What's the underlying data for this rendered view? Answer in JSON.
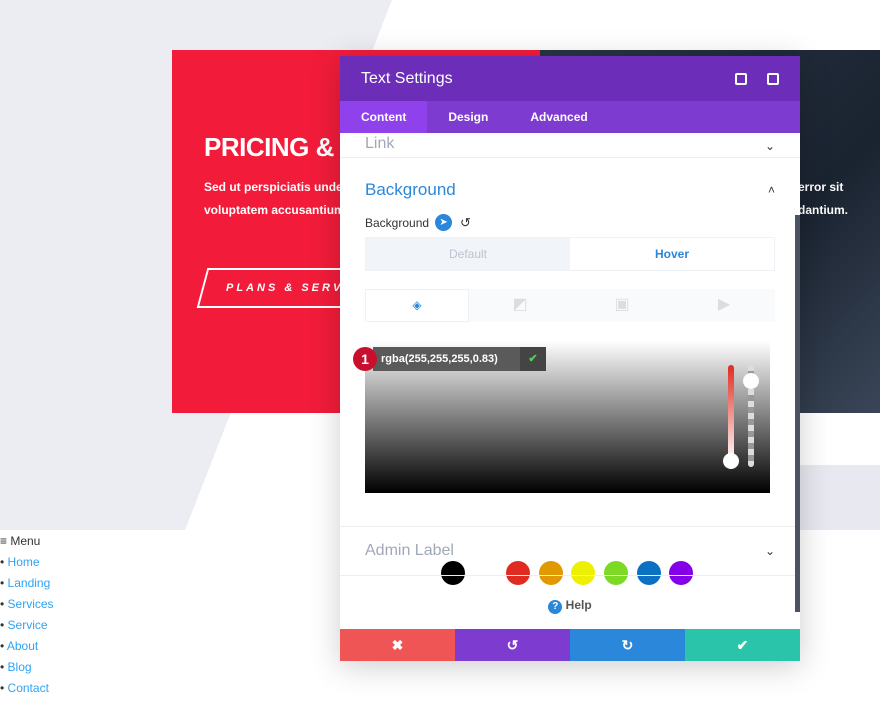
{
  "hero": {
    "title": "PRICING & PLA",
    "text_line1": "Sed ut perspiciatis unde o",
    "text_line2": "voluptatem accusantium",
    "button": "PLANS & SERVI",
    "right_line1": "error sit",
    "right_line2": "dantium."
  },
  "modal": {
    "title": "Text Settings",
    "tabs": [
      "Content",
      "Design",
      "Advanced"
    ],
    "link_label": "Link",
    "section": "Background",
    "field_label": "Background",
    "states": [
      "Default",
      "Hover"
    ],
    "color_value": "rgba(255,255,255,0.83)",
    "badge": "1",
    "admin_label": "Admin Label",
    "help": "Help",
    "swatches": [
      "#000000",
      "#ffffff",
      "#e02b20",
      "#e09900",
      "#edf000",
      "#7cda24",
      "#0c71c3",
      "#8300e9"
    ],
    "accent": "#6c2eb9"
  },
  "footer": {
    "icons": [
      "close-icon",
      "undo-icon",
      "redo-icon",
      "check-icon"
    ],
    "colors": [
      "#ef5555",
      "#7e3bd0",
      "#2b87da",
      "#29c4a9"
    ]
  },
  "menu": {
    "label": "≡ Menu",
    "items": [
      "Home",
      "Landing",
      "Services",
      "Service",
      "About",
      "Blog",
      "Contact"
    ]
  }
}
